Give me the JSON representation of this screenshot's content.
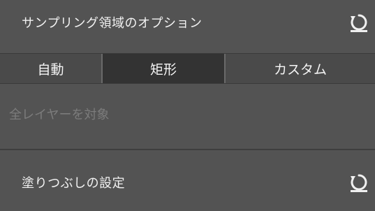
{
  "sampling": {
    "title": "サンプリング領域のオプション",
    "reset_icon": "reset-arrow-icon"
  },
  "segments": [
    {
      "label": "自動",
      "selected": false
    },
    {
      "label": "矩形",
      "selected": true
    },
    {
      "label": "カスタム",
      "selected": false
    }
  ],
  "checkbox": {
    "label": "全レイヤーを対象",
    "enabled": false
  },
  "fill": {
    "title": "塗りつぶしの設定",
    "reset_icon": "reset-arrow-icon"
  },
  "colors": {
    "background": "#535353",
    "segment_bg": "#4a4a4a",
    "segment_active_bg": "#333333",
    "text": "#f2f2f2",
    "disabled_text": "#7c7c7c"
  }
}
